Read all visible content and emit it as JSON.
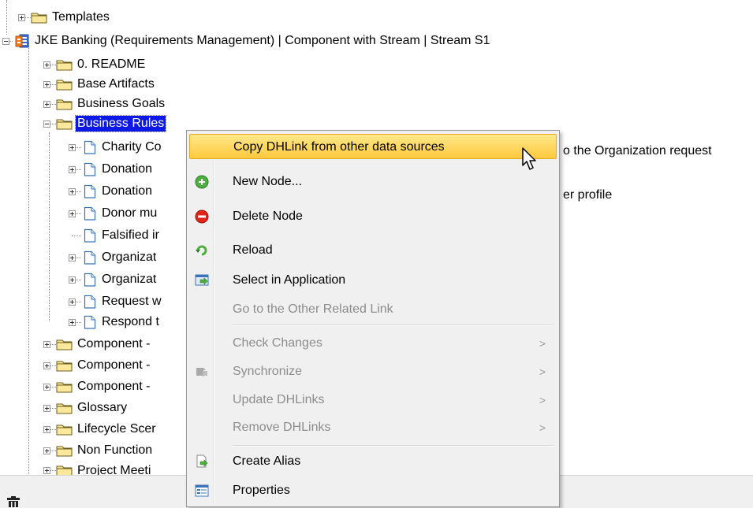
{
  "tree": {
    "items": [
      {
        "label": "Templates"
      },
      {
        "label": "JKE Banking (Requirements Management) | Component with Stream | Stream S1"
      },
      {
        "label": "0. README"
      },
      {
        "label": "Base Artifacts"
      },
      {
        "label": "Business Goals"
      },
      {
        "label": "Business Rules"
      },
      {
        "label": "Charity Co"
      },
      {
        "label": "Donation"
      },
      {
        "label": "Donation"
      },
      {
        "label": "Donor mu"
      },
      {
        "label": "Falsified ir"
      },
      {
        "label": "Organizat"
      },
      {
        "label": "Organizat"
      },
      {
        "label": "Request w"
      },
      {
        "label": "Respond t"
      },
      {
        "label": "Component -"
      },
      {
        "label": "Component -"
      },
      {
        "label": "Component -"
      },
      {
        "label": "Glossary"
      },
      {
        "label": "Lifecycle Scer"
      },
      {
        "label": "Non Function"
      },
      {
        "label": "Project Meeti"
      }
    ],
    "overflow_texts": [
      "o the Organization request",
      "er profile"
    ]
  },
  "context_menu": {
    "items": [
      {
        "label": "Copy DHLink from other data sources",
        "icon": "none",
        "state": "highlighted"
      },
      {
        "label": "New Node...",
        "icon": "green-plus-icon",
        "state": "enabled"
      },
      {
        "label": "Delete Node",
        "icon": "red-minus-icon",
        "state": "enabled"
      },
      {
        "label": "Reload",
        "icon": "reload-icon",
        "state": "enabled"
      },
      {
        "label": "Select in Application",
        "icon": "select-in-app-icon",
        "state": "enabled"
      },
      {
        "label": "Go to the Other Related Link",
        "icon": "none",
        "state": "disabled"
      },
      {
        "label": "Check Changes",
        "icon": "none",
        "state": "disabled",
        "submenu": ">"
      },
      {
        "label": "Synchronize",
        "icon": "sync-icon",
        "state": "disabled",
        "submenu": ">"
      },
      {
        "label": "Update DHLinks",
        "icon": "none",
        "state": "disabled",
        "submenu": ">"
      },
      {
        "label": "Remove DHLinks",
        "icon": "none",
        "state": "disabled",
        "submenu": ">"
      },
      {
        "label": "Create Alias",
        "icon": "create-alias-icon",
        "state": "enabled"
      },
      {
        "label": "Properties",
        "icon": "properties-icon",
        "state": "enabled"
      }
    ]
  },
  "colors": {
    "selection": "#0b18e6",
    "menu_highlight": "#ffd04d",
    "folder": "#f5d76e"
  }
}
